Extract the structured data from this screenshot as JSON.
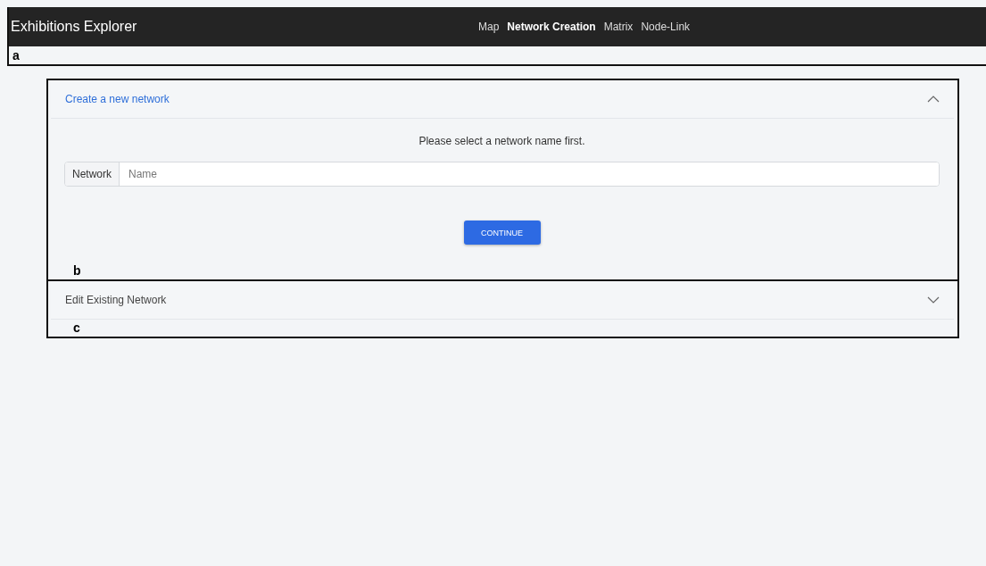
{
  "app_bar": {
    "title": "Exhibitions Explorer",
    "nav": [
      {
        "label": "Map",
        "selected": false
      },
      {
        "label": "Network Creation",
        "selected": true
      },
      {
        "label": "Matrix",
        "selected": false
      },
      {
        "label": "Node-Link",
        "selected": false
      }
    ],
    "annotation": "a"
  },
  "panels": [
    {
      "title": "Create a new network",
      "expanded": true,
      "message": "Please select a network name first.",
      "field": {
        "label": "Network",
        "placeholder": "Name"
      },
      "button": "CONTINUE",
      "annotation": "b"
    },
    {
      "title": "Edit Existing Network",
      "expanded": false,
      "annotation": "c"
    }
  ]
}
